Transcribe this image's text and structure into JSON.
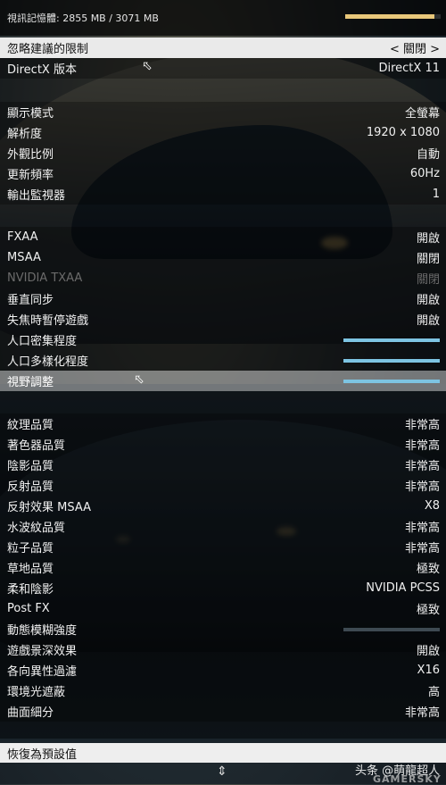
{
  "memory": {
    "label": "視訊記憶體: 2855 MB / 3071 MB",
    "fill": 0.93
  },
  "rows": [
    {
      "label": "忽略建議的限制",
      "value": "< 關閉 >",
      "state": "selected",
      "kind": "text"
    },
    {
      "label": "DirectX 版本",
      "value": "DirectX 11",
      "state": "normal",
      "kind": "text"
    },
    {
      "label": "顯示模式",
      "value": "全螢幕",
      "state": "normal",
      "kind": "text"
    },
    {
      "label": "解析度",
      "value": "1920 x 1080",
      "state": "normal",
      "kind": "text"
    },
    {
      "label": "外觀比例",
      "value": "自動",
      "state": "normal",
      "kind": "text"
    },
    {
      "label": "更新頻率",
      "value": "60Hz",
      "state": "normal",
      "kind": "text"
    },
    {
      "label": "輸出監視器",
      "value": "1",
      "state": "normal",
      "kind": "text"
    },
    {
      "label": "FXAA",
      "value": "開啟",
      "state": "normal",
      "kind": "text"
    },
    {
      "label": "MSAA",
      "value": "關閉",
      "state": "normal",
      "kind": "text"
    },
    {
      "label": "NVIDIA TXAA",
      "value": "關閉",
      "state": "disabled",
      "kind": "text"
    },
    {
      "label": "垂直同步",
      "value": "開啟",
      "state": "normal",
      "kind": "text"
    },
    {
      "label": "失焦時暫停遊戲",
      "value": "開啟",
      "state": "normal",
      "kind": "text"
    },
    {
      "label": "人口密集程度",
      "value": "",
      "state": "normal",
      "kind": "slider",
      "level": 1.0
    },
    {
      "label": "人口多樣化程度",
      "value": "",
      "state": "normal",
      "kind": "slider",
      "level": 1.0
    },
    {
      "label": "視野調整",
      "value": "",
      "state": "focused",
      "kind": "slider",
      "level": 1.0
    },
    {
      "label": "紋理品質",
      "value": "非常高",
      "state": "normal",
      "kind": "text"
    },
    {
      "label": "著色器品質",
      "value": "非常高",
      "state": "normal",
      "kind": "text"
    },
    {
      "label": "陰影品質",
      "value": "非常高",
      "state": "normal",
      "kind": "text"
    },
    {
      "label": "反射品質",
      "value": "非常高",
      "state": "normal",
      "kind": "text"
    },
    {
      "label": "反射效果 MSAA",
      "value": "X8",
      "state": "normal",
      "kind": "text"
    },
    {
      "label": "水波紋品質",
      "value": "非常高",
      "state": "normal",
      "kind": "text"
    },
    {
      "label": "粒子品質",
      "value": "非常高",
      "state": "normal",
      "kind": "text"
    },
    {
      "label": "草地品質",
      "value": "極致",
      "state": "normal",
      "kind": "text"
    },
    {
      "label": "柔和陰影",
      "value": "NVIDIA PCSS",
      "state": "normal",
      "kind": "text"
    },
    {
      "label": "Post FX",
      "value": "極致",
      "state": "normal",
      "kind": "text"
    },
    {
      "label": "動態模糊強度",
      "value": "",
      "state": "normal",
      "kind": "slider",
      "level": 0.0
    },
    {
      "label": "遊戲景深效果",
      "value": "開啟",
      "state": "normal",
      "kind": "text"
    },
    {
      "label": "各向異性過濾",
      "value": "X16",
      "state": "normal",
      "kind": "text"
    },
    {
      "label": "環境光遮蔽",
      "value": "高",
      "state": "normal",
      "kind": "text"
    },
    {
      "label": "曲面細分",
      "value": "非常高",
      "state": "normal",
      "kind": "text"
    }
  ],
  "reset_label": "恢復為預設值",
  "watermark": {
    "line1": "头条 @萌龍超人",
    "line2": "GAMERSKY"
  },
  "icons": {
    "scroll": "scroll-updown-icon",
    "cursor": "mouse-cursor-icon"
  }
}
